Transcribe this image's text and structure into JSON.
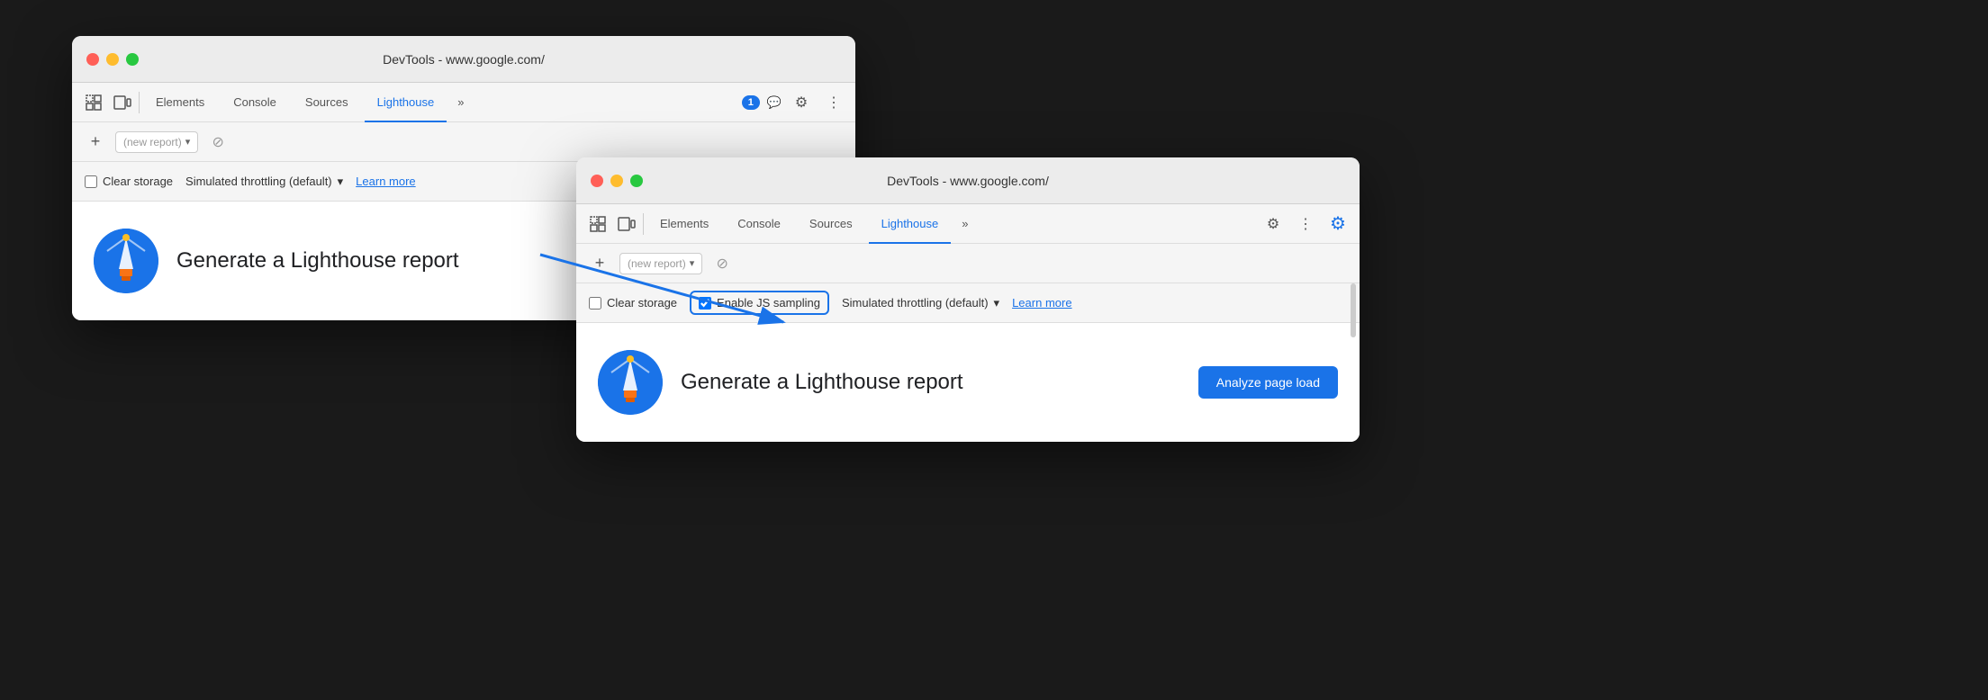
{
  "back_window": {
    "title": "DevTools - www.google.com/",
    "tabs": [
      {
        "label": "Elements",
        "active": false
      },
      {
        "label": "Console",
        "active": false
      },
      {
        "label": "Sources",
        "active": false
      },
      {
        "label": "Lighthouse",
        "active": true
      },
      {
        "label": "»",
        "active": false
      }
    ],
    "report_bar": {
      "placeholder": "(new report)",
      "dropdown_icon": "▾",
      "clear_icon": "⊘"
    },
    "options": {
      "clear_storage": "Clear storage",
      "throttling": "Simulated throttling (default)",
      "throttling_icon": "▾",
      "learn_more": "Learn more"
    },
    "main": {
      "generate_text": "Generate a Lighthouse report"
    },
    "toolbar_right": {
      "badge": "1",
      "settings_icon": "⚙",
      "more_icon": "⋮"
    }
  },
  "front_window": {
    "title": "DevTools - www.google.com/",
    "tabs": [
      {
        "label": "Elements",
        "active": false
      },
      {
        "label": "Console",
        "active": false
      },
      {
        "label": "Sources",
        "active": false
      },
      {
        "label": "Lighthouse",
        "active": true
      },
      {
        "label": "»",
        "active": false
      }
    ],
    "report_bar": {
      "placeholder": "(new report)",
      "dropdown_icon": "▾",
      "clear_icon": "⊘"
    },
    "options": {
      "clear_storage": "Clear storage",
      "enable_js": "Enable JS sampling",
      "throttling": "Simulated throttling (default)",
      "throttling_icon": "▾",
      "learn_more": "Learn more"
    },
    "main": {
      "generate_text": "Generate a Lighthouse report",
      "analyze_btn": "Analyze page load"
    },
    "toolbar_right": {
      "settings_icon": "⚙",
      "more_icon": "⋮",
      "gear_blue_icon": "⚙"
    }
  },
  "icons": {
    "selector": "⬚",
    "device": "⬛",
    "chat": "💬",
    "settings": "⚙",
    "more": "⋮",
    "plus": "+",
    "cancel": "⊘",
    "chevron_down": "▾"
  }
}
